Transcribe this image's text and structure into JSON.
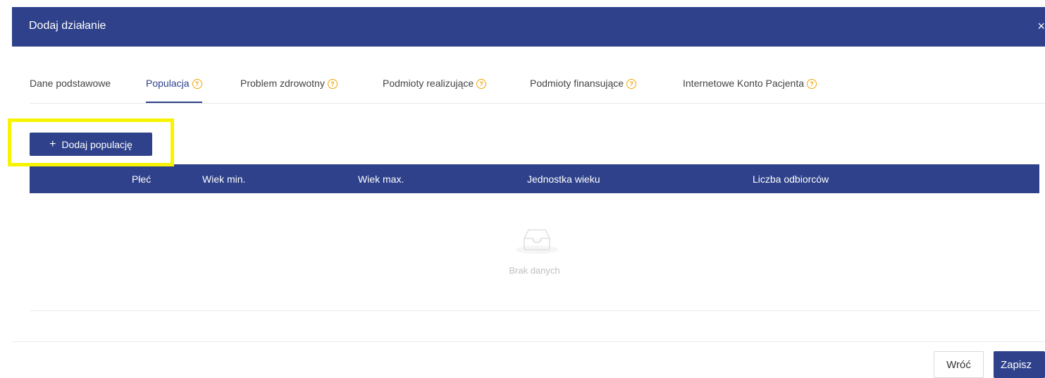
{
  "modal": {
    "title": "Dodaj działanie",
    "close": "×"
  },
  "tabs": [
    {
      "label": "Dane podstawowe",
      "help": false
    },
    {
      "label": "Populacja",
      "help": true,
      "active": true
    },
    {
      "label": "Problem zdrowotny",
      "help": true
    },
    {
      "label": "Podmioty realizujące",
      "help": true
    },
    {
      "label": "Podmioty finansujące",
      "help": true
    },
    {
      "label": "Internetowe Konto Pacjenta",
      "help": true
    }
  ],
  "help_glyph": "?",
  "add_button": {
    "icon": "+",
    "label": "Dodaj populację"
  },
  "table": {
    "columns": [
      "Płeć",
      "Wiek min.",
      "Wiek max.",
      "Jednostka wieku",
      "Liczba odbiorców"
    ],
    "rows": [],
    "empty_text": "Brak danych"
  },
  "footer": {
    "back_label": "Wróć",
    "save_label": "Zapisz"
  },
  "colors": {
    "primary": "#2e418a",
    "help_icon": "#f0a500",
    "highlight": "#f6f400"
  },
  "icons": {
    "close": "close-icon",
    "help": "question-circle-icon",
    "plus": "plus-icon",
    "empty": "empty-inbox-icon"
  }
}
